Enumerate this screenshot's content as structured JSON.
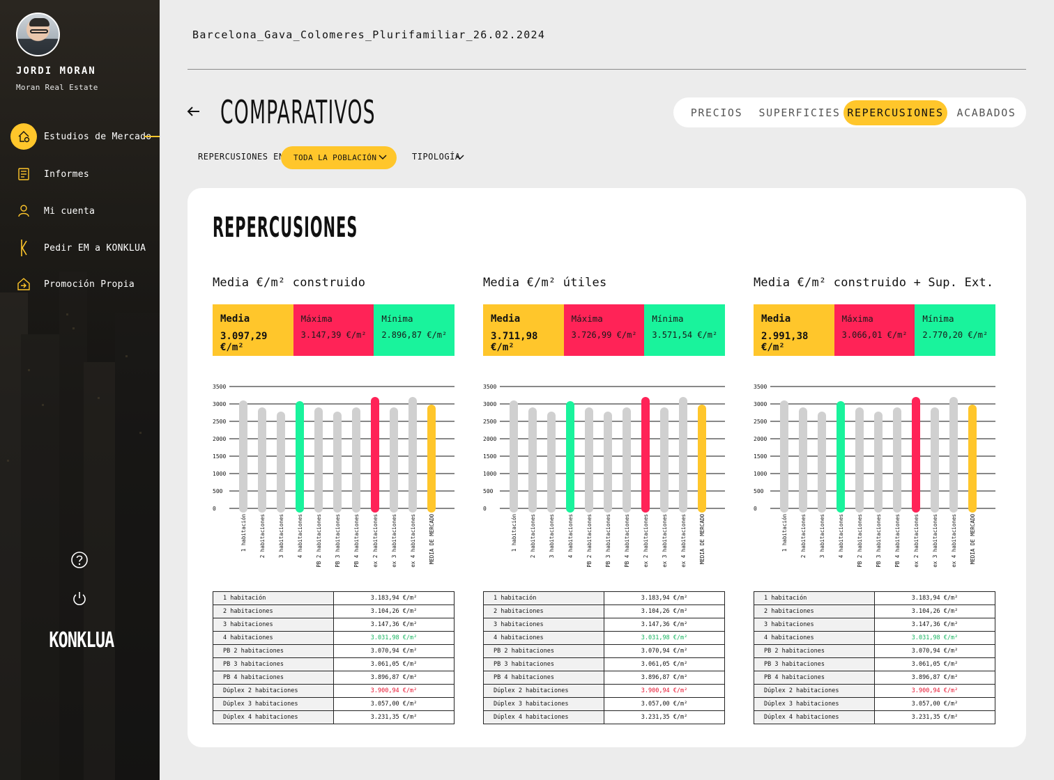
{
  "sidebar": {
    "user_name": "JORDI MORAN",
    "company": "Moran Real Estate",
    "nav": [
      {
        "label": "Estudios de Mercado",
        "icon": "house-coin-icon",
        "active": true
      },
      {
        "label": "Informes",
        "icon": "report-icon"
      },
      {
        "label": "Mi cuenta",
        "icon": "user-icon"
      },
      {
        "label": "Pedir EM a KONKLUA",
        "icon": "konklua-k-icon"
      },
      {
        "label": "Promoción Propia",
        "icon": "promotion-house-icon"
      }
    ],
    "logo": "KONKLUA"
  },
  "header": {
    "file_title": "Barcelona_Gava_Colomeres_Plurifamiliar_26.02.2024",
    "page_title": "COMPARATIVOS",
    "tabs": [
      "PRECIOS",
      "SUPERFICIES",
      "REPERCUSIONES",
      "ACABADOS"
    ],
    "active_tab": "REPERCUSIONES"
  },
  "filters": {
    "label": "REPERCUSIONES EN",
    "scope": "TODA LA POBLACIÓN",
    "tipologia": "TIPOLOGÍA"
  },
  "card": {
    "title": "REPERCUSIONES",
    "panels": [
      {
        "title": "Media €/m² construido",
        "stats": {
          "avg_label": "Media",
          "avg": "3.097,29 €/m²",
          "max_label": "Máxima",
          "max": "3.147,39 €/m²",
          "min_label": "Mínima",
          "min": "2.896,87 €/m²"
        },
        "rows": [
          {
            "k": "1 habitación",
            "v": "3.183,94 €/m²"
          },
          {
            "k": "2 habitaciones",
            "v": "3.104,26 €/m²"
          },
          {
            "k": "3 habitaciones",
            "v": "3.147,36 €/m²"
          },
          {
            "k": "4 habitaciones",
            "v": "3.031,98 €/m²",
            "flag": "low"
          },
          {
            "k": "PB 2 habitaciones",
            "v": "3.070,94 €/m²"
          },
          {
            "k": "PB 3 habitaciones",
            "v": "3.061,05 €/m²"
          },
          {
            "k": "PB 4 habitaciones",
            "v": "3.896,87 €/m²"
          },
          {
            "k": "Dúplex 2 habitaciones",
            "v": "3.900,94 €/m²",
            "flag": "high"
          },
          {
            "k": "Dúplex 3 habitaciones",
            "v": "3.057,00 €/m²"
          },
          {
            "k": "Dúplex 4 habitaciones",
            "v": "3.231,35 €/m²"
          }
        ]
      },
      {
        "title": "Media €/m² útiles",
        "stats": {
          "avg_label": "Media",
          "avg": "3.711,98 €/m²",
          "max_label": "Máxima",
          "max": "3.726,99 €/m²",
          "min_label": "Mínima",
          "min": "3.571,54 €/m²"
        },
        "rows": [
          {
            "k": "1 habitación",
            "v": "3.183,94 €/m²"
          },
          {
            "k": "2 habitaciones",
            "v": "3.104,26 €/m²"
          },
          {
            "k": "3 habitaciones",
            "v": "3.147,36 €/m²"
          },
          {
            "k": "4 habitaciones",
            "v": "3.031,98 €/m²",
            "flag": "low"
          },
          {
            "k": "PB 2 habitaciones",
            "v": "3.070,94 €/m²"
          },
          {
            "k": "PB 3 habitaciones",
            "v": "3.061,05 €/m²"
          },
          {
            "k": "PB 4 habitaciones",
            "v": "3.896,87 €/m²"
          },
          {
            "k": "Dúplex 2 habitaciones",
            "v": "3.900,94 €/m²",
            "flag": "high"
          },
          {
            "k": "Dúplex 3 habitaciones",
            "v": "3.057,00 €/m²"
          },
          {
            "k": "Dúplex 4 habitaciones",
            "v": "3.231,35 €/m²"
          }
        ]
      },
      {
        "title": "Media €/m² construido + Sup. Ext.",
        "stats": {
          "avg_label": "Media",
          "avg": "2.991,38 €/m²",
          "max_label": "Máxima",
          "max": "3.066,01 €/m²",
          "min_label": "Mínima",
          "min": "2.770,20 €/m²"
        },
        "rows": [
          {
            "k": "1 habitación",
            "v": "3.183,94 €/m²"
          },
          {
            "k": "2 habitaciones",
            "v": "3.104,26 €/m²"
          },
          {
            "k": "3 habitaciones",
            "v": "3.147,36 €/m²"
          },
          {
            "k": "4 habitaciones",
            "v": "3.031,98 €/m²",
            "flag": "low"
          },
          {
            "k": "PB 2 habitaciones",
            "v": "3.070,94 €/m²"
          },
          {
            "k": "PB 3 habitaciones",
            "v": "3.061,05 €/m²"
          },
          {
            "k": "PB 4 habitaciones",
            "v": "3.896,87 €/m²"
          },
          {
            "k": "Dúplex 2 habitaciones",
            "v": "3.900,94 €/m²",
            "flag": "high"
          },
          {
            "k": "Dúplex 3 habitaciones",
            "v": "3.057,00 €/m²"
          },
          {
            "k": "Dúplex 4 habitaciones",
            "v": "3.231,35 €/m²"
          }
        ]
      }
    ]
  },
  "colors": {
    "accent": "#ffc62b",
    "max": "#ff2357",
    "min": "#19f39c",
    "bar": "#d0d0d0"
  },
  "chart_data": [
    {
      "type": "bar",
      "categories": [
        "1 habitación",
        "2 habitaciones",
        "3 habitaciones",
        "4 habitaciones",
        "PB 2 habitaciones",
        "PB 3 habitaciones",
        "PB 4 habitaciones",
        "Dúplex 2 habitaciones",
        "Dúplex 3 habitaciones",
        "Dúplex 4 habitaciones",
        "MEDIA DE MERCADO"
      ],
      "values": [
        3100,
        2900,
        2780,
        3080,
        2900,
        2780,
        2900,
        3200,
        2900,
        3200,
        2980
      ],
      "highlight": {
        "min": 3,
        "max": 7,
        "market": 10
      },
      "yticks": [
        0,
        500,
        1000,
        1500,
        2000,
        2500,
        3000,
        3500
      ],
      "ylim": [
        0,
        3500
      ],
      "grid": true
    },
    {
      "type": "bar",
      "categories": [
        "1 habitación",
        "2 habitaciones",
        "3 habitaciones",
        "4 habitaciones",
        "PB 2 habitaciones",
        "PB 3 habitaciones",
        "PB 4 habitaciones",
        "Dúplex 2 habitaciones",
        "Dúplex 3 habitaciones",
        "Dúplex 4 habitaciones",
        "MEDIA DE MERCADO"
      ],
      "values": [
        3100,
        2900,
        2780,
        3080,
        2900,
        2780,
        2900,
        3200,
        2900,
        3200,
        2980
      ],
      "highlight": {
        "min": 3,
        "max": 7,
        "market": 10
      },
      "yticks": [
        0,
        500,
        1000,
        1500,
        2000,
        2500,
        3000,
        3500
      ],
      "ylim": [
        0,
        3500
      ],
      "grid": true
    },
    {
      "type": "bar",
      "categories": [
        "1 habitación",
        "2 habitaciones",
        "3 habitaciones",
        "4 habitaciones",
        "PB 2 habitaciones",
        "PB 3 habitaciones",
        "PB 4 habitaciones",
        "Dúplex 2 habitaciones",
        "Dúplex 3 habitaciones",
        "Dúplex 4 habitaciones",
        "MEDIA DE MERCADO"
      ],
      "values": [
        3100,
        2900,
        2780,
        3080,
        2900,
        2780,
        2900,
        3200,
        2900,
        3200,
        2980
      ],
      "highlight": {
        "min": 3,
        "max": 7,
        "market": 10
      },
      "yticks": [
        0,
        500,
        1000,
        1500,
        2000,
        2500,
        3000,
        3500
      ],
      "ylim": [
        0,
        3500
      ],
      "grid": true
    }
  ]
}
